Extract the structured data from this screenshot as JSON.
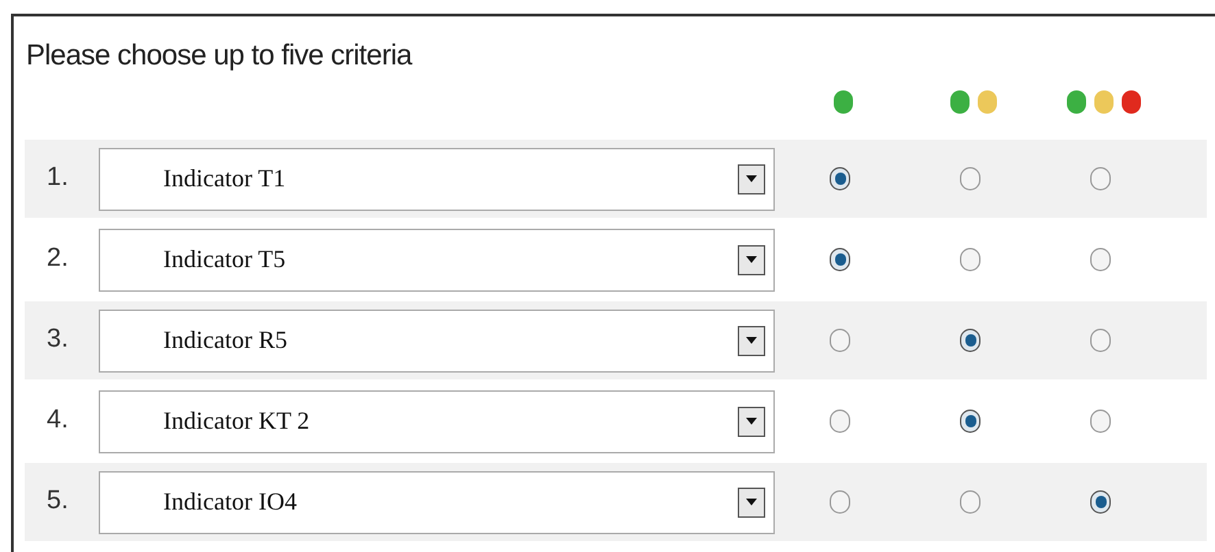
{
  "title": "Please choose up to five criteria",
  "levels": [
    {
      "dots": [
        {
          "color": "#3cb043"
        }
      ]
    },
    {
      "dots": [
        {
          "color": "#3cb043"
        },
        {
          "color": "#ecc85a"
        }
      ]
    },
    {
      "dots": [
        {
          "color": "#3cb043"
        },
        {
          "color": "#ecc85a"
        },
        {
          "color": "#e02a1e"
        }
      ]
    }
  ],
  "rows": [
    {
      "number": "1.",
      "value": "Indicator T1",
      "options": [
        {
          "selected": true
        },
        {
          "selected": false
        },
        {
          "selected": false
        }
      ]
    },
    {
      "number": "2.",
      "value": "Indicator T5",
      "options": [
        {
          "selected": true
        },
        {
          "selected": false
        },
        {
          "selected": false
        }
      ]
    },
    {
      "number": "3.",
      "value": "Indicator R5",
      "options": [
        {
          "selected": false
        },
        {
          "selected": true
        },
        {
          "selected": false
        }
      ]
    },
    {
      "number": "4.",
      "value": "Indicator KT 2",
      "options": [
        {
          "selected": false
        },
        {
          "selected": true
        },
        {
          "selected": false
        }
      ]
    },
    {
      "number": "5.",
      "value": "Indicator IO4",
      "options": [
        {
          "selected": false
        },
        {
          "selected": false
        },
        {
          "selected": true
        }
      ]
    }
  ]
}
